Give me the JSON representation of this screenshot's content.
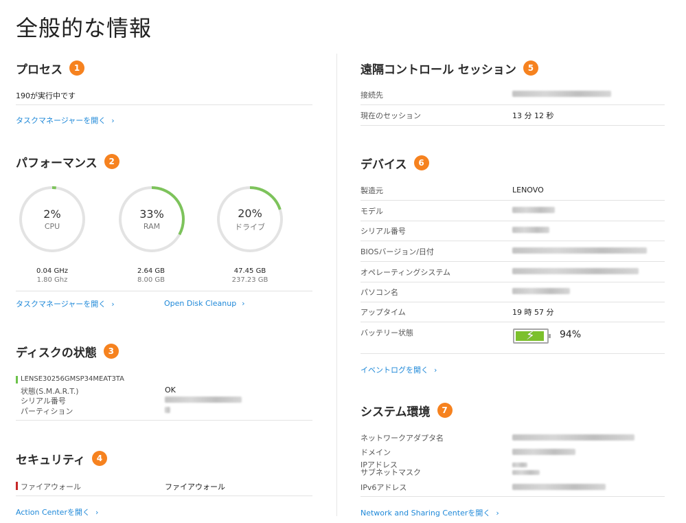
{
  "page_title": "全般的な情報",
  "process": {
    "title": "プロセス",
    "badge": "1",
    "running": "190が実行中です",
    "link": "タスクマネージャーを開く"
  },
  "performance": {
    "title": "パフォーマンス",
    "badge": "2",
    "gauges": [
      {
        "pct": "2%",
        "name": "CPU",
        "value": 0.02,
        "used": "0.04 GHz",
        "total": "1.80 Ghz"
      },
      {
        "pct": "33%",
        "name": "RAM",
        "value": 0.33,
        "used": "2.64 GB",
        "total": "8.00 GB"
      },
      {
        "pct": "20%",
        "name": "ドライブ",
        "value": 0.2,
        "used": "47.45 GB",
        "total": "237.23 GB"
      }
    ],
    "gauge_color": "#7dc35b",
    "track_color": "#e3e3e3",
    "link_taskmgr": "タスクマネージャーを開く",
    "link_cleanup": "Open Disk Cleanup"
  },
  "disk": {
    "title": "ディスクの状態",
    "badge": "3",
    "drive": "LENSE30256GMSP34MEAT3TA",
    "status_label": "状態(S.M.A.R.T.)",
    "status_value": "OK",
    "serial_label": "シリアル番号",
    "partition_label": "パーティション"
  },
  "security": {
    "title": "セキュリティ",
    "badge": "4",
    "firewall_label": "ファイアウォール",
    "firewall_value": "ファイアウォール",
    "link": "Action Centerを開く"
  },
  "remote": {
    "title": "遠隔コントロール セッション",
    "badge": "5",
    "connect_label": "接続先",
    "session_label": "現在のセッション",
    "session_value": "13 分 12 秒"
  },
  "device": {
    "title": "デバイス",
    "badge": "6",
    "maker_label": "製造元",
    "maker_value": "LENOVO",
    "model_label": "モデル",
    "serial_label": "シリアル番号",
    "bios_label": "BIOSバージョン/日付",
    "os_label": "オペレーティングシステム",
    "pc_label": "パソコン名",
    "uptime_label": "アップタイム",
    "uptime_value": "19 時 57 分",
    "battery_label": "バッテリー状態",
    "battery_value": "94%",
    "battery_level": 0.94,
    "link": "イベントログを開く"
  },
  "system": {
    "title": "システム環境",
    "badge": "7",
    "adapter_label": "ネットワークアダプタ名",
    "domain_label": "ドメイン",
    "ip_label": "IPアドレス",
    "subnet_label": "サブネットマスク",
    "ipv6_label": "IPv6アドレス",
    "link": "Network and Sharing Centerを開く"
  },
  "chevron": "›"
}
